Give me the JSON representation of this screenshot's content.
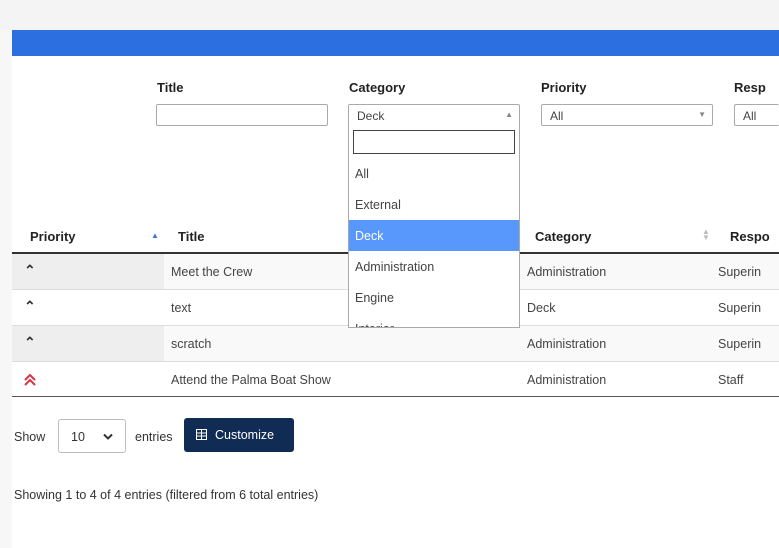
{
  "filters": {
    "title": {
      "label": "Title",
      "value": ""
    },
    "category": {
      "label": "Category",
      "value": "Deck"
    },
    "priority": {
      "label": "Priority",
      "value": "All"
    },
    "responsible": {
      "label": "Resp",
      "value": "All"
    }
  },
  "dropdown": {
    "search_value": "",
    "options": [
      "All",
      "External",
      "Deck",
      "Administration",
      "Engine",
      "Interior"
    ],
    "selected": "Deck"
  },
  "table": {
    "columns": [
      "Priority",
      "Title",
      "Category",
      "Respo"
    ],
    "rows": [
      {
        "priority_icon": "chevron-up-icon",
        "title": "Meet the Crew",
        "category": "Administration",
        "responsible": "Superin"
      },
      {
        "priority_icon": "chevron-up-icon",
        "title": "text",
        "category": "Deck",
        "responsible": "Superin"
      },
      {
        "priority_icon": "chevron-up-icon",
        "title": "scratch",
        "category": "Administration",
        "responsible": "Superin"
      },
      {
        "priority_icon": "double-chevron-up-icon",
        "title": "Attend the Palma Boat Show",
        "category": "Administration",
        "responsible": "Staff"
      }
    ]
  },
  "footer": {
    "show_label": "Show",
    "page_size": "10",
    "entries_label": "entries",
    "customize_label": "Customize",
    "info": "Showing 1 to 4 of 4 entries (filtered from 6 total entries)"
  },
  "colors": {
    "brand_blue": "#2c6fe0",
    "button_navy": "#102c55",
    "selected_option": "#5897fb",
    "urgent_red": "#d9333f"
  }
}
